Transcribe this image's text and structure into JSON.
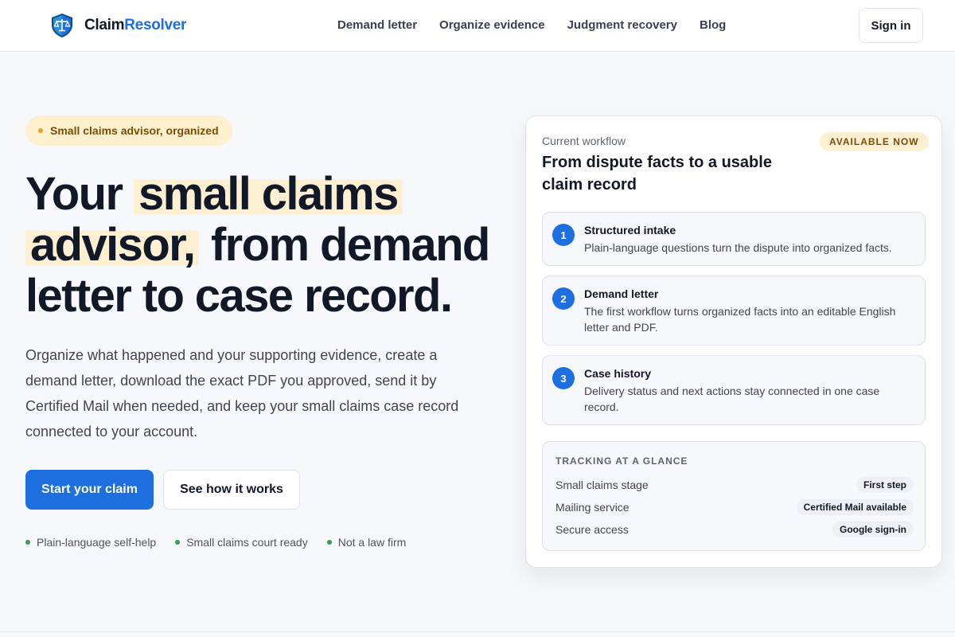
{
  "header": {
    "brand": {
      "name_part1": "Claim",
      "name_part2": "Resolver",
      "logo_icon": "shield-scales-icon"
    },
    "nav": [
      "Demand letter",
      "Organize evidence",
      "Judgment recovery",
      "Blog"
    ],
    "sign_in_label": "Sign in"
  },
  "hero": {
    "pill_label": "Small claims advisor, organized",
    "headline": {
      "part1": "Your",
      "highlight1": "small claims",
      "highlight2": "advisor,",
      "part2": "from demand letter to case record."
    },
    "subcopy": "Organize what happened and your supporting evidence, create a demand letter, download the exact PDF you approved, send it by Certified Mail when needed, and keep your small claims case record connected to your account.",
    "primary_cta": "Start your claim",
    "secondary_cta": "See how it works",
    "bullets": [
      "Plain-language self-help",
      "Small claims court ready",
      "Not a law firm"
    ]
  },
  "card": {
    "eyebrow": "Current workflow",
    "title": "From dispute facts to a usable claim record",
    "badge": "AVAILABLE NOW",
    "steps": [
      {
        "num": "1",
        "title": "Structured intake",
        "desc": "Plain-language questions turn the dispute into organized facts."
      },
      {
        "num": "2",
        "title": "Demand letter",
        "desc": "The first workflow turns organized facts into an editable English letter and PDF."
      },
      {
        "num": "3",
        "title": "Case history",
        "desc": "Delivery status and next actions stay connected in one case record."
      }
    ],
    "tracking": {
      "heading": "TRACKING AT A GLANCE",
      "rows": [
        {
          "label": "Small claims stage",
          "value": "First step"
        },
        {
          "label": "Mailing service",
          "value": "Certified Mail available"
        },
        {
          "label": "Secure access",
          "value": "Google sign-in"
        }
      ]
    }
  },
  "colors": {
    "accent": "#1d6fe0",
    "highlight": "#fdefd2",
    "success_dot": "#3a9a4f",
    "warning_dot": "#e0a526"
  }
}
